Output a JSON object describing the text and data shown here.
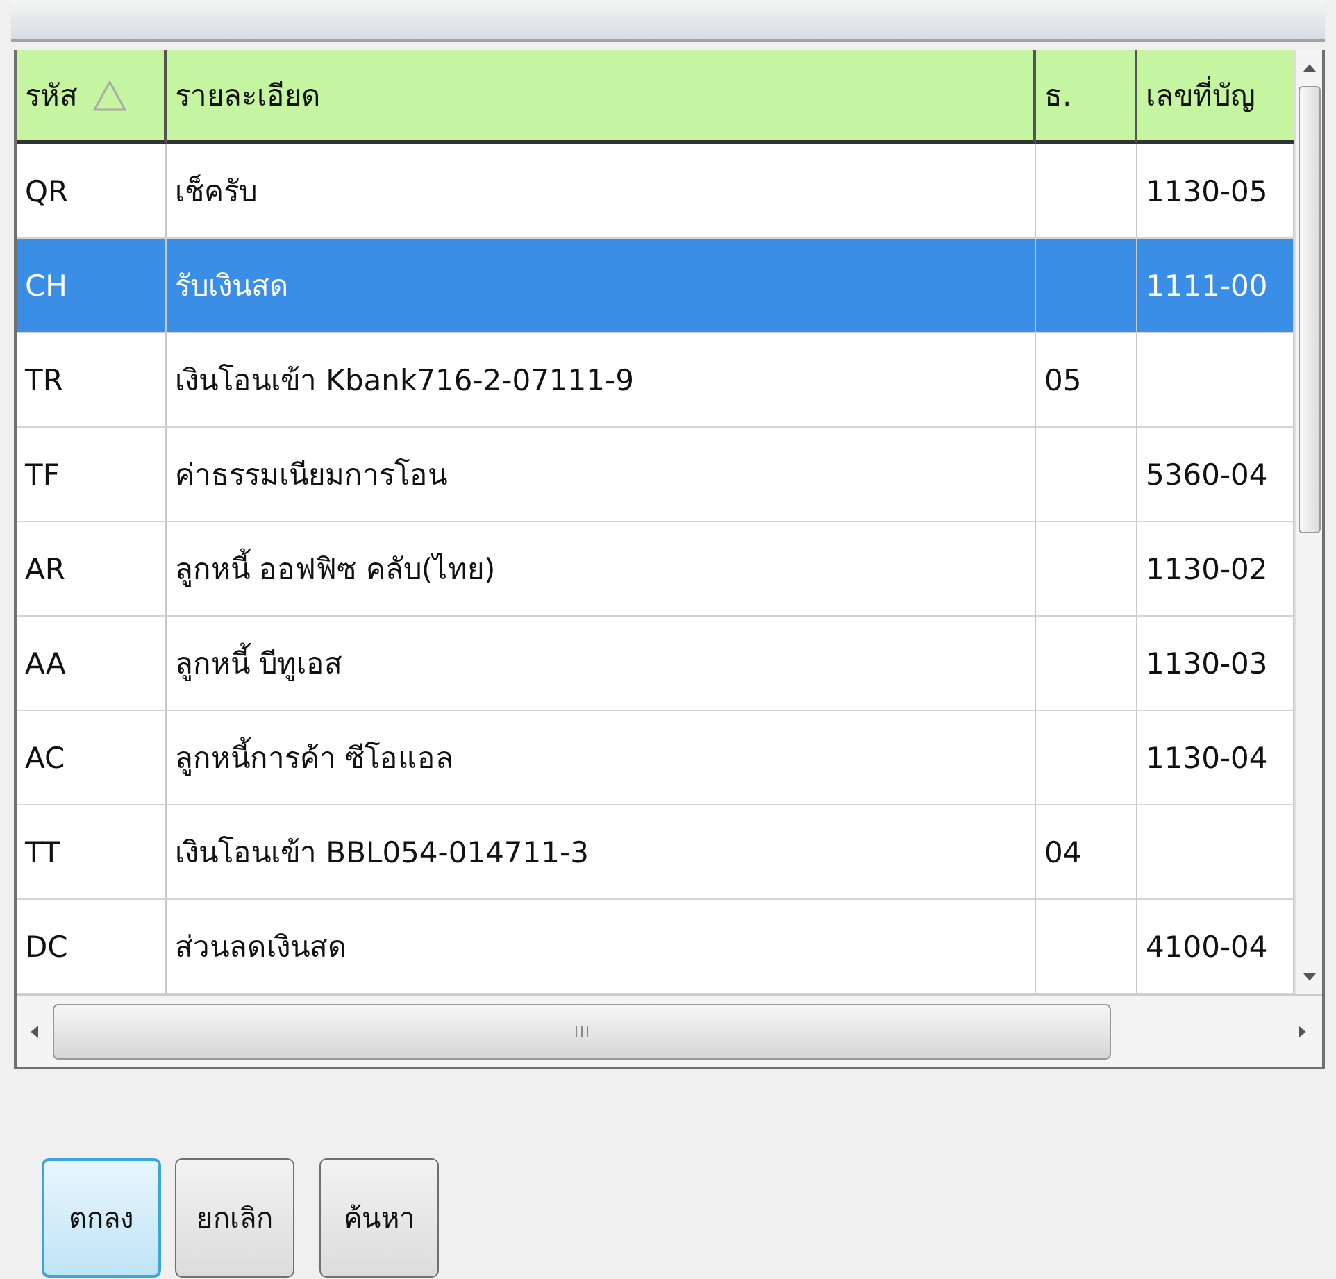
{
  "table": {
    "columns": [
      {
        "label": "รหัส",
        "sorted": true
      },
      {
        "label": "รายละเอียด",
        "sorted": false
      },
      {
        "label": "ธ.",
        "sorted": false
      },
      {
        "label": "เลขที่บัญ",
        "sorted": false
      }
    ],
    "rows": [
      {
        "cells": [
          "QR",
          "เช็ครับ",
          "",
          "1130-05"
        ],
        "selected": false
      },
      {
        "cells": [
          "CH",
          "รับเงินสด",
          "",
          "1111-00"
        ],
        "selected": true
      },
      {
        "cells": [
          "TR",
          "เงินโอนเข้า Kbank716-2-07111-9",
          "05",
          ""
        ],
        "selected": false
      },
      {
        "cells": [
          "TF",
          "ค่าธรรมเนียมการโอน",
          "",
          "5360-04"
        ],
        "selected": false
      },
      {
        "cells": [
          "AR",
          "ลูกหนี้ ออฟฟิซ คลับ(ไทย)",
          "",
          "1130-02"
        ],
        "selected": false
      },
      {
        "cells": [
          "AA",
          "ลูกหนี้ บีทูเอส",
          "",
          "1130-03"
        ],
        "selected": false
      },
      {
        "cells": [
          "AC",
          "ลูกหนี้การค้า ซีโอแอล",
          "",
          "1130-04"
        ],
        "selected": false
      },
      {
        "cells": [
          "TT",
          "เงินโอนเข้า BBL054-014711-3",
          "04",
          ""
        ],
        "selected": false
      },
      {
        "cells": [
          "DC",
          "ส่วนลดเงินสด",
          "",
          "4100-04"
        ],
        "selected": false
      }
    ]
  },
  "buttons": [
    {
      "label": "ตกลง",
      "focused": true
    },
    {
      "label": "ยกเลิก",
      "focused": false
    },
    {
      "label": "ค้นหา",
      "focused": false
    }
  ]
}
